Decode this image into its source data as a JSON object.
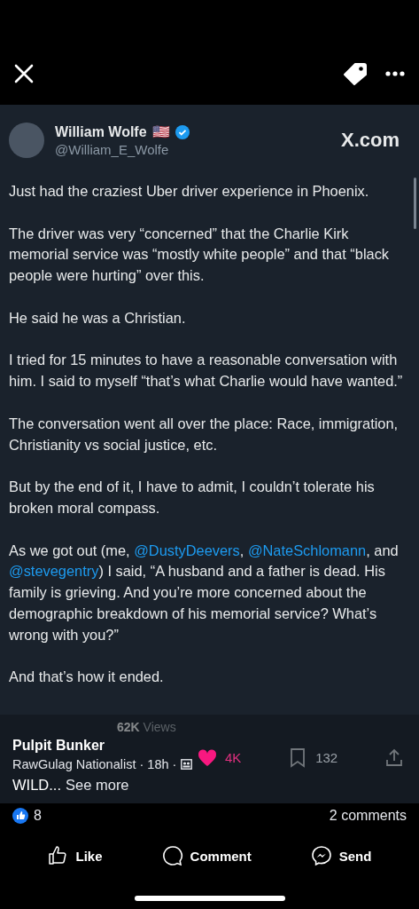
{
  "tweet": {
    "author": "William Wolfe",
    "flag": "🇺🇸",
    "handle": "@William_E_Wolfe",
    "source": "X.com",
    "paragraphs": [
      [
        {
          "kind": "text",
          "text": "Just had the craziest Uber driver experience in Phoenix."
        }
      ],
      [
        {
          "kind": "text",
          "text": "The driver was very “concerned” that the Charlie Kirk memorial service was “mostly white people” and that “black people were hurting” over this."
        }
      ],
      [
        {
          "kind": "text",
          "text": "He said he was a Christian."
        }
      ],
      [
        {
          "kind": "text",
          "text": "I tried for 15 minutes to have a reasonable conversation with him. I said to myself “that’s what Charlie would have wanted.”"
        }
      ],
      [
        {
          "kind": "text",
          "text": "The conversation went all over the place: Race, immigration, Christianity vs social justice, etc."
        }
      ],
      [
        {
          "kind": "text",
          "text": "But by the end of it, I have to admit, I couldn’t tolerate his broken moral compass."
        }
      ],
      [
        {
          "kind": "text",
          "text": "As we got out (me, "
        },
        {
          "kind": "mention",
          "text": "@DustyDeevers"
        },
        {
          "kind": "text",
          "text": ", "
        },
        {
          "kind": "mention",
          "text": "@NateSchlomann"
        },
        {
          "kind": "text",
          "text": ", and "
        },
        {
          "kind": "mention",
          "text": "@stevegentry"
        },
        {
          "kind": "text",
          "text": ") I said, “A husband and a father is dead. His family is grieving. And you’re more concerned about the demographic breakdown of his memorial service? What’s wrong with you?”"
        }
      ],
      [
        {
          "kind": "text",
          "text": "And that’s how it ended."
        }
      ]
    ],
    "timestamp": "**62K** Views",
    "stats": [
      {
        "kind": "like",
        "text": "4K"
      },
      {
        "kind": "bookmark",
        "text": "132"
      },
      {
        "kind": "share"
      }
    ]
  },
  "post": {
    "page_name": "Pulpit Bunker",
    "meta": "RawGulag Nationalist · 18h ·",
    "caption": "WILD...",
    "see_more": "See more"
  },
  "engagement": {
    "reactions": "8",
    "comments": "2 comments"
  },
  "actions": [
    {
      "kind": "like",
      "label": "Like"
    },
    {
      "kind": "comment",
      "label": "Comment"
    },
    {
      "kind": "send",
      "label": "Send"
    }
  ]
}
